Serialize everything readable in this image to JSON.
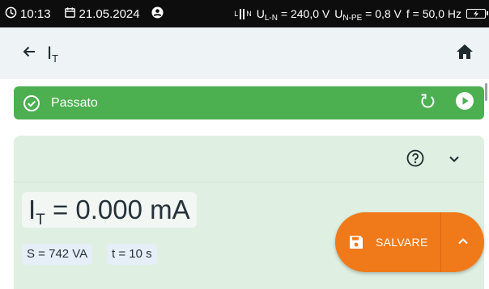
{
  "status_bar": {
    "time": "10:13",
    "date": "21.05.2024",
    "phase_glyph": "L",
    "neutral_glyph": "N",
    "uln_label": "U",
    "uln_sub": "L-N",
    "uln_value": " = 240,0 V",
    "unpe_label": "U",
    "unpe_sub": "N-PE",
    "unpe_value": " = 0,8 V",
    "freq": "f = 50,0 Hz",
    "icons": [
      "clock-icon",
      "calendar-icon",
      "account-icon",
      "battery-charging-icon"
    ]
  },
  "app_bar": {
    "title_main": "I",
    "title_sub": "T",
    "icons": [
      "arrow-back-icon",
      "home-icon"
    ]
  },
  "result_banner": {
    "label": "Passato",
    "color": "#4caf50",
    "icons": [
      "check-circle-icon",
      "restart-icon",
      "play-circle-icon"
    ]
  },
  "measurement": {
    "result_main": "I",
    "result_sub": "T",
    "result_value": " = 0.000 mA",
    "param_s": "S = 742 VA",
    "param_t": "t = 10 s",
    "icons": [
      "help-circle-icon",
      "chevron-down-icon"
    ]
  },
  "save_button": {
    "label": "SALVARE",
    "color": "#f07a1a",
    "icons": [
      "save-icon",
      "chevron-up-icon"
    ]
  },
  "colors": {
    "statusbar_bg": "#0d0d0d",
    "appbar_bg": "#eef3f5",
    "card_bg": "#dff0e2"
  }
}
